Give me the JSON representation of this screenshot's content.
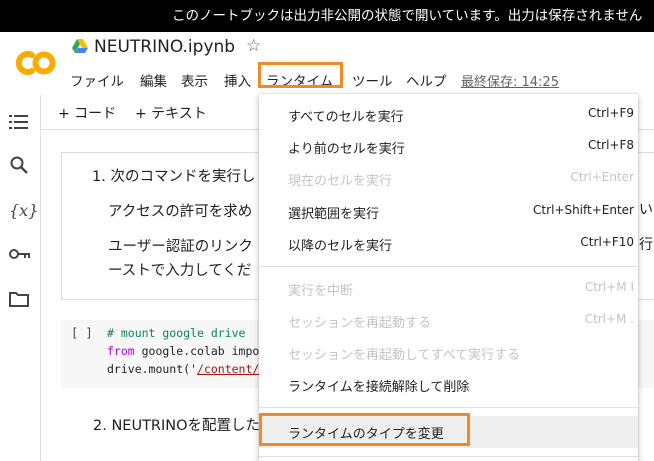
{
  "banner": {
    "text": "このノートブックは出力非公開の状態で開いています。出力は保存されません"
  },
  "header": {
    "logo_text": "CO",
    "notebook_title": "NEUTRINO.ipynb",
    "menu": [
      "ファイル",
      "編集",
      "表示",
      "挿入",
      "ランタイム",
      "ツール",
      "ヘルプ"
    ],
    "last_saved": "最終保存: 14:25"
  },
  "toolbar": {
    "add_code": "+ コード",
    "add_text": "+ テキスト"
  },
  "sidebar": {
    "variables_label": "{x}"
  },
  "cell1": {
    "line1": "1. 次のコマンドを実行し",
    "line2": "アクセスの許可を求め",
    "line3": "ユーザー認証のリンク",
    "line4": "ーストで入力してくだ",
    "right_line2": "い",
    "right_line3": "行"
  },
  "code_cell": {
    "bracket": "[ ]",
    "line1_comment": "# mount google drive",
    "line2_kw": "from",
    "line2_rest": " google.colab impo",
    "line3_prefix": "drive.mount('",
    "line3_str": "/content/"
  },
  "step2": "2. NEUTRINOを配置した",
  "dropdown": {
    "items": [
      {
        "label": "すべてのセルを実行",
        "shortcut": "Ctrl+F9",
        "disabled": false
      },
      {
        "label": "より前のセルを実行",
        "shortcut": "Ctrl+F8",
        "disabled": false
      },
      {
        "label": "現在のセルを実行",
        "shortcut": "Ctrl+Enter",
        "disabled": true
      },
      {
        "label": "選択範囲を実行",
        "shortcut": "Ctrl+Shift+Enter",
        "disabled": false
      },
      {
        "label": "以降のセルを実行",
        "shortcut": "Ctrl+F10",
        "disabled": false
      },
      {
        "label": "実行を中断",
        "shortcut": "Ctrl+M I",
        "disabled": true
      },
      {
        "label": "セッションを再起動する",
        "shortcut": "Ctrl+M .",
        "disabled": true
      },
      {
        "label": "セッションを再起動してすべて実行する",
        "shortcut": "",
        "disabled": true
      },
      {
        "label": "ランタイムを接続解除して削除",
        "shortcut": "",
        "disabled": false
      },
      {
        "label": "ランタイムのタイプを変更",
        "shortcut": "",
        "disabled": false
      }
    ]
  },
  "colors": {
    "highlight_outline": "#f08a24",
    "logo_orange": "#f9ab00"
  }
}
